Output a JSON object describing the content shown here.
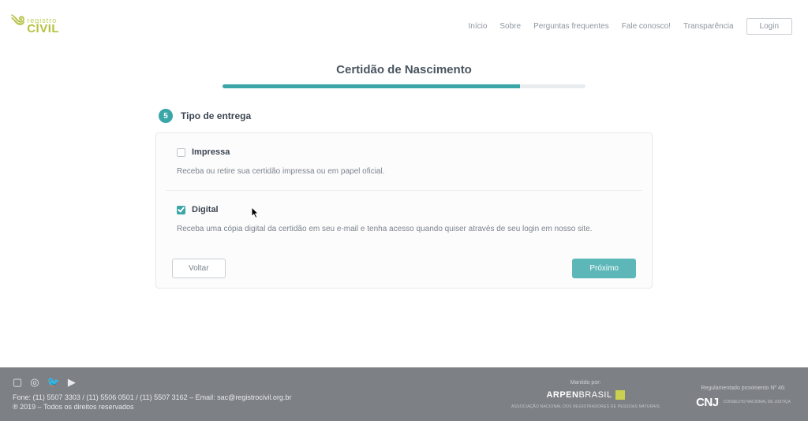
{
  "header": {
    "logo_top": "registro",
    "logo_main": "CIVIL",
    "nav": [
      "Início",
      "Sobre",
      "Perguntas frequentes",
      "Fale conosco!",
      "Transparência"
    ],
    "login": "Login"
  },
  "page": {
    "title": "Certidão de Nascimento",
    "progress_percent": 82
  },
  "step": {
    "number": "5",
    "title": "Tipo de entrega"
  },
  "options": {
    "impressa": {
      "title": "Impressa",
      "desc": "Receba ou retire sua certidão impressa ou em papel oficial.",
      "checked": false
    },
    "digital": {
      "title": "Digital",
      "desc": "Receba uma cópia digital da certidão em seu e-mail e tenha acesso quando quiser através de seu login em nosso site.",
      "checked": true
    }
  },
  "actions": {
    "back": "Voltar",
    "next": "Próximo"
  },
  "footer": {
    "contact": "Fone: (11) 5507 3303 / (11) 5506 0501 / (11) 5507 3162 – Email: sac@registrocivil.org.br",
    "copyright": "® 2019 – Todos os direitos reservados",
    "mantido": "Mantido por:",
    "arpen": "ARPEN",
    "arpen_suffix": "BRASIL",
    "arpen_sub": "ASSOCIAÇÃO NACIONAL DOS REGISTRADORES DE PESSOAS NATURAIS",
    "regulamentado": "Regulamentado provimento Nº 46:",
    "cnj": "CNJ",
    "cnj_sub": "CONSELHO NACIONAL DE JUSTIÇA"
  }
}
